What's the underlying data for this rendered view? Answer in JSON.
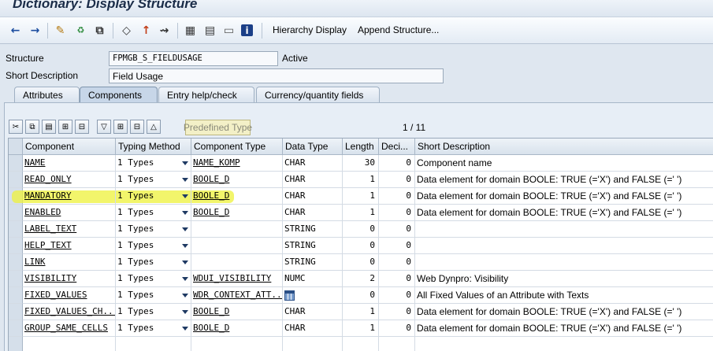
{
  "window": {
    "title": "Dictionary: Display Structure"
  },
  "toolbar": {
    "icons": [
      "back-arrow-icon",
      "forward-arrow-icon",
      "edit-pencil-icon",
      "switch-display-change-icon",
      "other-object-icon",
      "check-icon",
      "activate-icon",
      "where-used-icon",
      "object-list-icon",
      "navigation-window-icon",
      "graphic-icon",
      "info-icon"
    ],
    "hierarchy_display": "Hierarchy Display",
    "append_structure": "Append Structure..."
  },
  "header": {
    "structure_label": "Structure",
    "structure_value": "FPMGB_S_FIELDUSAGE",
    "status": "Active",
    "short_desc_label": "Short Description",
    "short_desc_value": "Field Usage"
  },
  "tabs": [
    {
      "label": "Attributes",
      "active": false
    },
    {
      "label": "Components",
      "active": true
    },
    {
      "label": "Entry help/check",
      "active": false
    },
    {
      "label": "Currency/quantity fields",
      "active": false
    }
  ],
  "grid_toolbar": {
    "icons": [
      "cut-icon",
      "copy-icon",
      "paste-icon",
      "insert-row-icon",
      "delete-row-icon",
      "filter-icon",
      "expand-icon",
      "collapse-icon",
      "sort-icon"
    ],
    "predefined_type": "Predefined Type",
    "pager": "1 / 11"
  },
  "table": {
    "columns": [
      "Component",
      "Typing Method",
      "Component Type",
      "Data Type",
      "Length",
      "Deci...",
      "Short Description"
    ],
    "rows": [
      {
        "component": "NAME",
        "typing": "1 Types",
        "comp_type": "NAME_KOMP",
        "data_type": "CHAR",
        "length": "30",
        "decimals": "0",
        "description": "Component name"
      },
      {
        "component": "READ_ONLY",
        "typing": "1 Types",
        "comp_type": "BOOLE_D",
        "data_type": "CHAR",
        "length": "1",
        "decimals": "0",
        "description": "Data element for domain BOOLE: TRUE (='X') and FALSE (=' ')"
      },
      {
        "component": "MANDATORY",
        "typing": "1 Types",
        "comp_type": "BOOLE_D",
        "data_type": "CHAR",
        "length": "1",
        "decimals": "0",
        "description": "Data element for domain BOOLE: TRUE (='X') and FALSE (=' ')"
      },
      {
        "component": "ENABLED",
        "typing": "1 Types",
        "comp_type": "BOOLE_D",
        "data_type": "CHAR",
        "length": "1",
        "decimals": "0",
        "description": "Data element for domain BOOLE: TRUE (='X') and FALSE (=' ')"
      },
      {
        "component": "LABEL_TEXT",
        "typing": "1 Types",
        "comp_type": "",
        "data_type": "STRING",
        "length": "0",
        "decimals": "0",
        "description": ""
      },
      {
        "component": "HELP_TEXT",
        "typing": "1 Types",
        "comp_type": "",
        "data_type": "STRING",
        "length": "0",
        "decimals": "0",
        "description": ""
      },
      {
        "component": "LINK",
        "typing": "1 Types",
        "comp_type": "",
        "data_type": "STRING",
        "length": "0",
        "decimals": "0",
        "description": ""
      },
      {
        "component": "VISIBILITY",
        "typing": "1 Types",
        "comp_type": "WDUI_VISIBILITY",
        "data_type": "NUMC",
        "length": "2",
        "decimals": "0",
        "description": "Web Dynpro: Visibility"
      },
      {
        "component": "FIXED_VALUES",
        "typing": "1 Types",
        "comp_type": "WDR_CONTEXT_ATT...",
        "data_type": "",
        "data_type_icon": "table-type-icon",
        "length": "0",
        "decimals": "0",
        "description": "All Fixed Values of an Attribute with Texts"
      },
      {
        "component": "FIXED_VALUES_CH...",
        "typing": "1 Types",
        "comp_type": "BOOLE_D",
        "data_type": "CHAR",
        "length": "1",
        "decimals": "0",
        "description": "Data element for domain BOOLE: TRUE (='X') and FALSE (=' ')"
      },
      {
        "component": "GROUP_SAME_CELLS",
        "typing": "1 Types",
        "comp_type": "BOOLE_D",
        "data_type": "CHAR",
        "length": "1",
        "decimals": "0",
        "description": "Data element for domain BOOLE: TRUE (='X') and FALSE (=' ')"
      },
      {
        "component": "",
        "typing": "",
        "comp_type": "",
        "data_type": "",
        "length": "",
        "decimals": "",
        "description": ""
      }
    ],
    "highlighted_row": 2,
    "highlight_color": "#eef23a"
  },
  "colors": {
    "background": "#dfe7f0",
    "title": "#1a2c48",
    "accent": "#1f3a63"
  }
}
